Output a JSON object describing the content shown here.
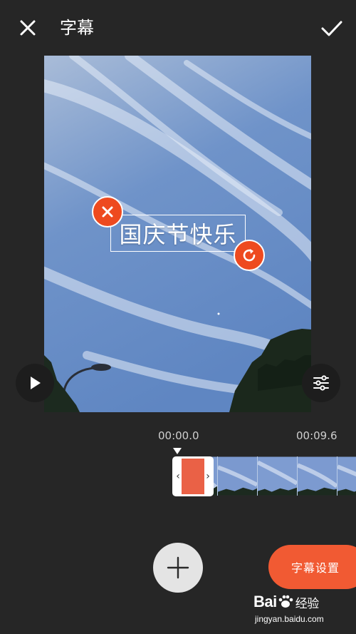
{
  "header": {
    "title": "字幕",
    "close_icon": "close-icon",
    "confirm_icon": "check-icon"
  },
  "preview": {
    "subtitle_text": "国庆节快乐",
    "delete_icon": "close-icon",
    "rotate_icon": "rotate-icon"
  },
  "controls": {
    "play_icon": "play-icon",
    "adjust_icon": "sliders-icon"
  },
  "timeline": {
    "start_time": "00:00.0",
    "end_time": "00:09.6",
    "clip_left_handle": "‹",
    "clip_right_handle": "›"
  },
  "actions": {
    "add_icon": "plus-icon",
    "settings_label": "字幕设置"
  },
  "watermark": {
    "logo_left": "Bai",
    "logo_right": "经验",
    "url": "jingyan.baidu.com"
  },
  "colors": {
    "accent": "#f15a33",
    "background": "#262626",
    "clip": "#ea6146"
  }
}
